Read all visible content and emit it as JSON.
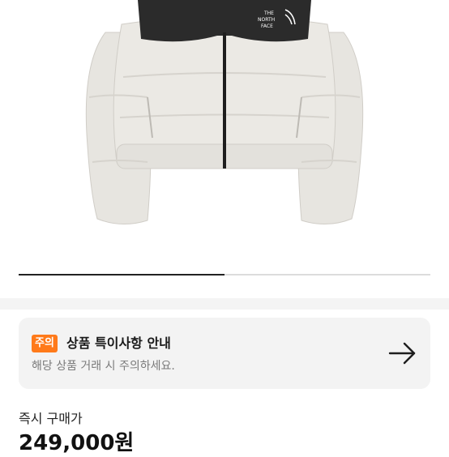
{
  "product": {
    "image_alt": "cream puffer jacket",
    "brand_logo_text": "THE NORTH FACE"
  },
  "carousel": {
    "current": 1,
    "total": 2
  },
  "notice": {
    "badge": "주의",
    "title": "상품 특이사항 안내",
    "description": "해당 상품 거래 시 주의하세요.",
    "arrow_icon": "arrow-right-icon"
  },
  "price": {
    "label": "즉시 구매가",
    "value": "249,000원"
  },
  "colors": {
    "badge": "#ff7a1a",
    "card_bg": "#f3f3f3"
  }
}
